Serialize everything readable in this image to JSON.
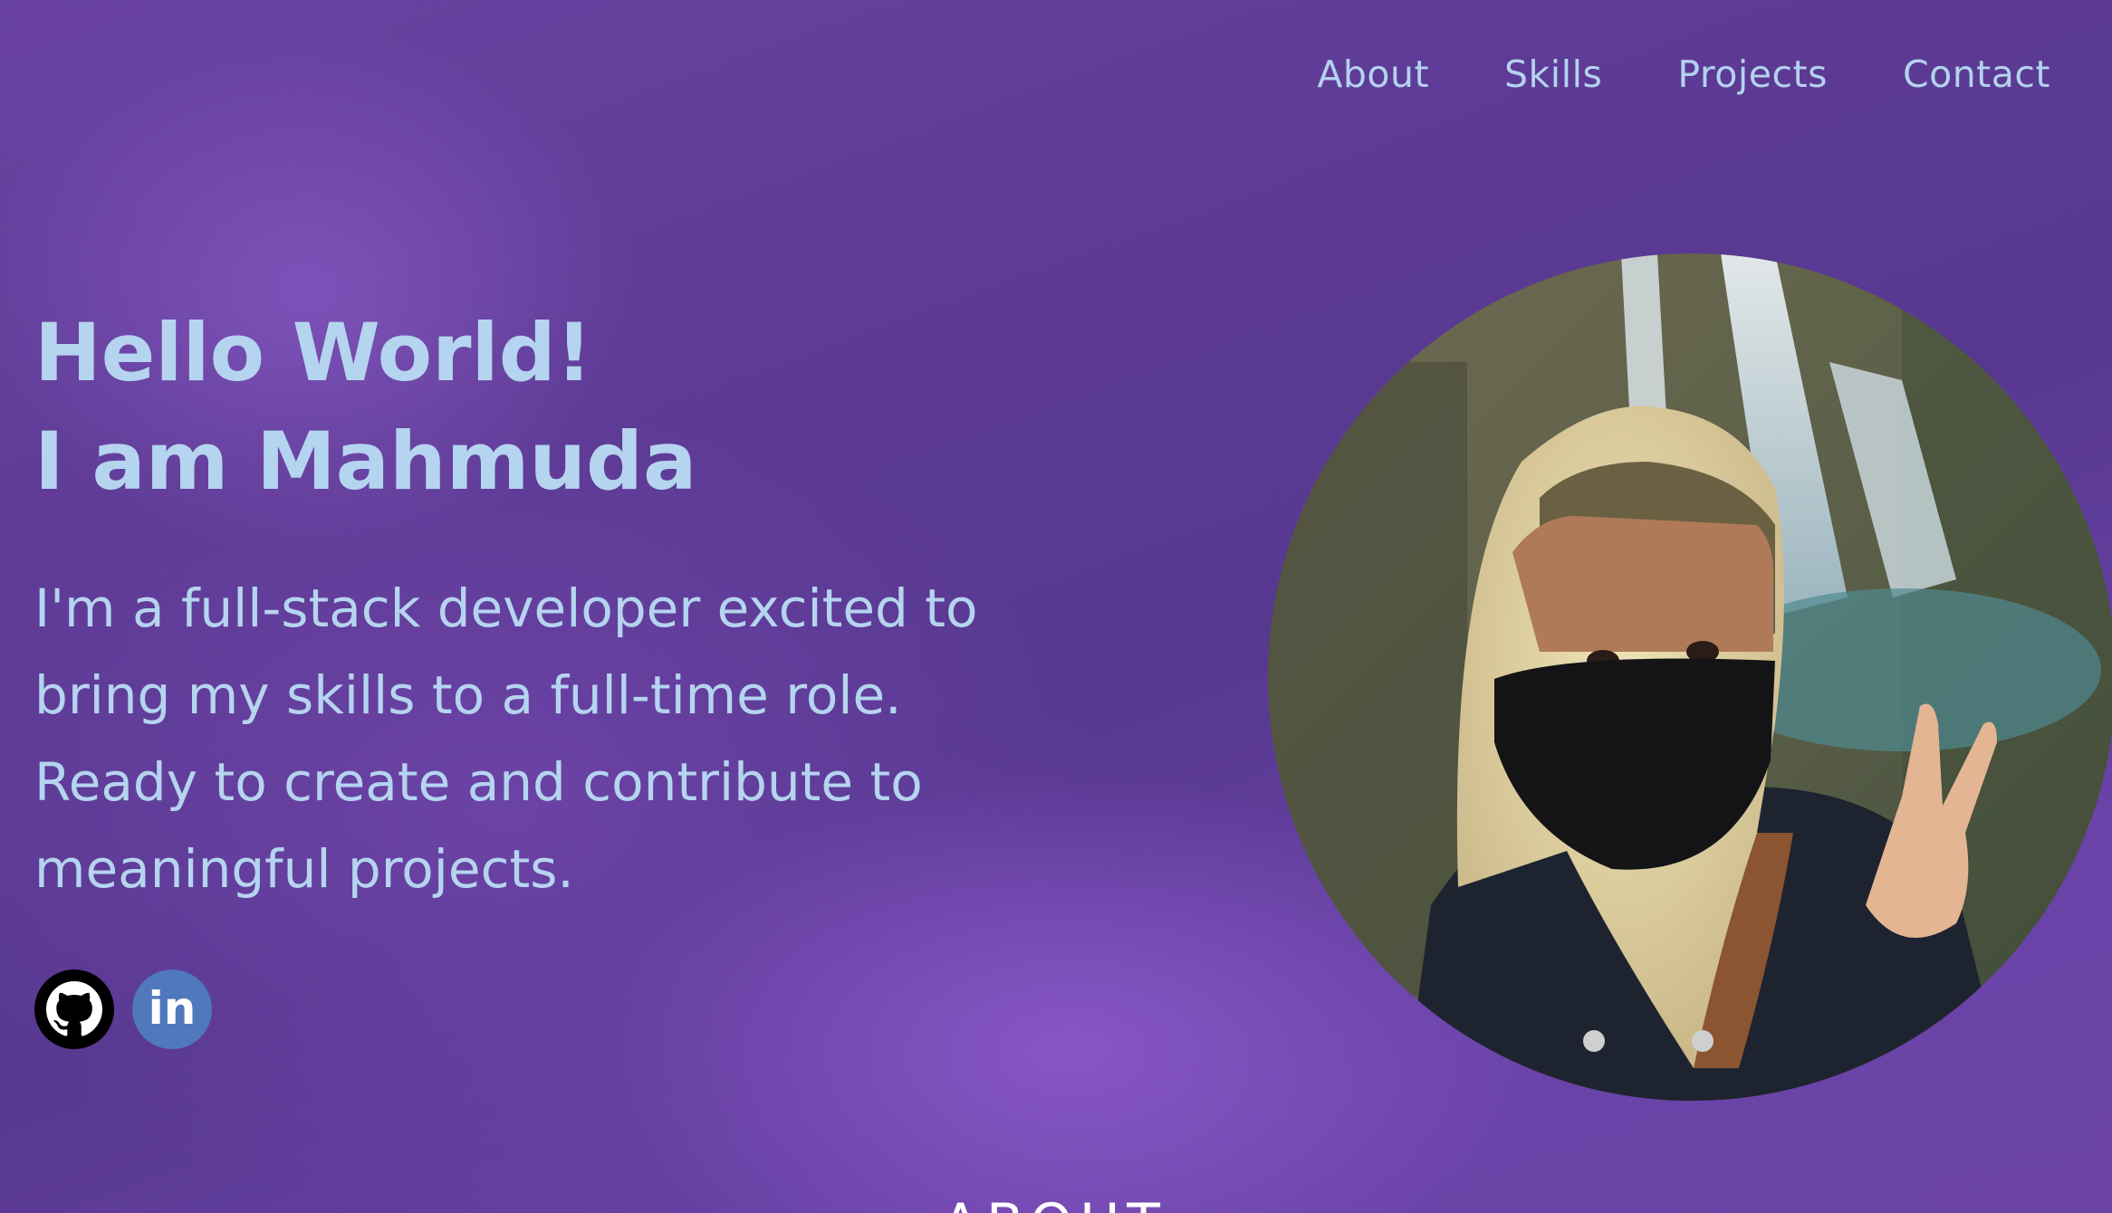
{
  "nav": {
    "items": [
      {
        "label": "About"
      },
      {
        "label": "Skills"
      },
      {
        "label": "Projects"
      },
      {
        "label": "Contact"
      }
    ]
  },
  "hero": {
    "title_line1": "Hello World!",
    "title_line2": "I am Mahmuda",
    "description_lines": [
      "I'm a full-stack developer excited to",
      "bring my skills to a full-time role.",
      "Ready to create and contribute to",
      "meaningful projects."
    ]
  },
  "socials": {
    "github_icon": "github-icon",
    "linkedin_icon": "linkedin-icon",
    "linkedin_glyph": "in"
  },
  "next_section_heading": "ABOUT",
  "colors": {
    "text": "#b5d4ef",
    "background": "#5e3b96",
    "github": "#000000",
    "linkedin": "#4f78bd"
  }
}
